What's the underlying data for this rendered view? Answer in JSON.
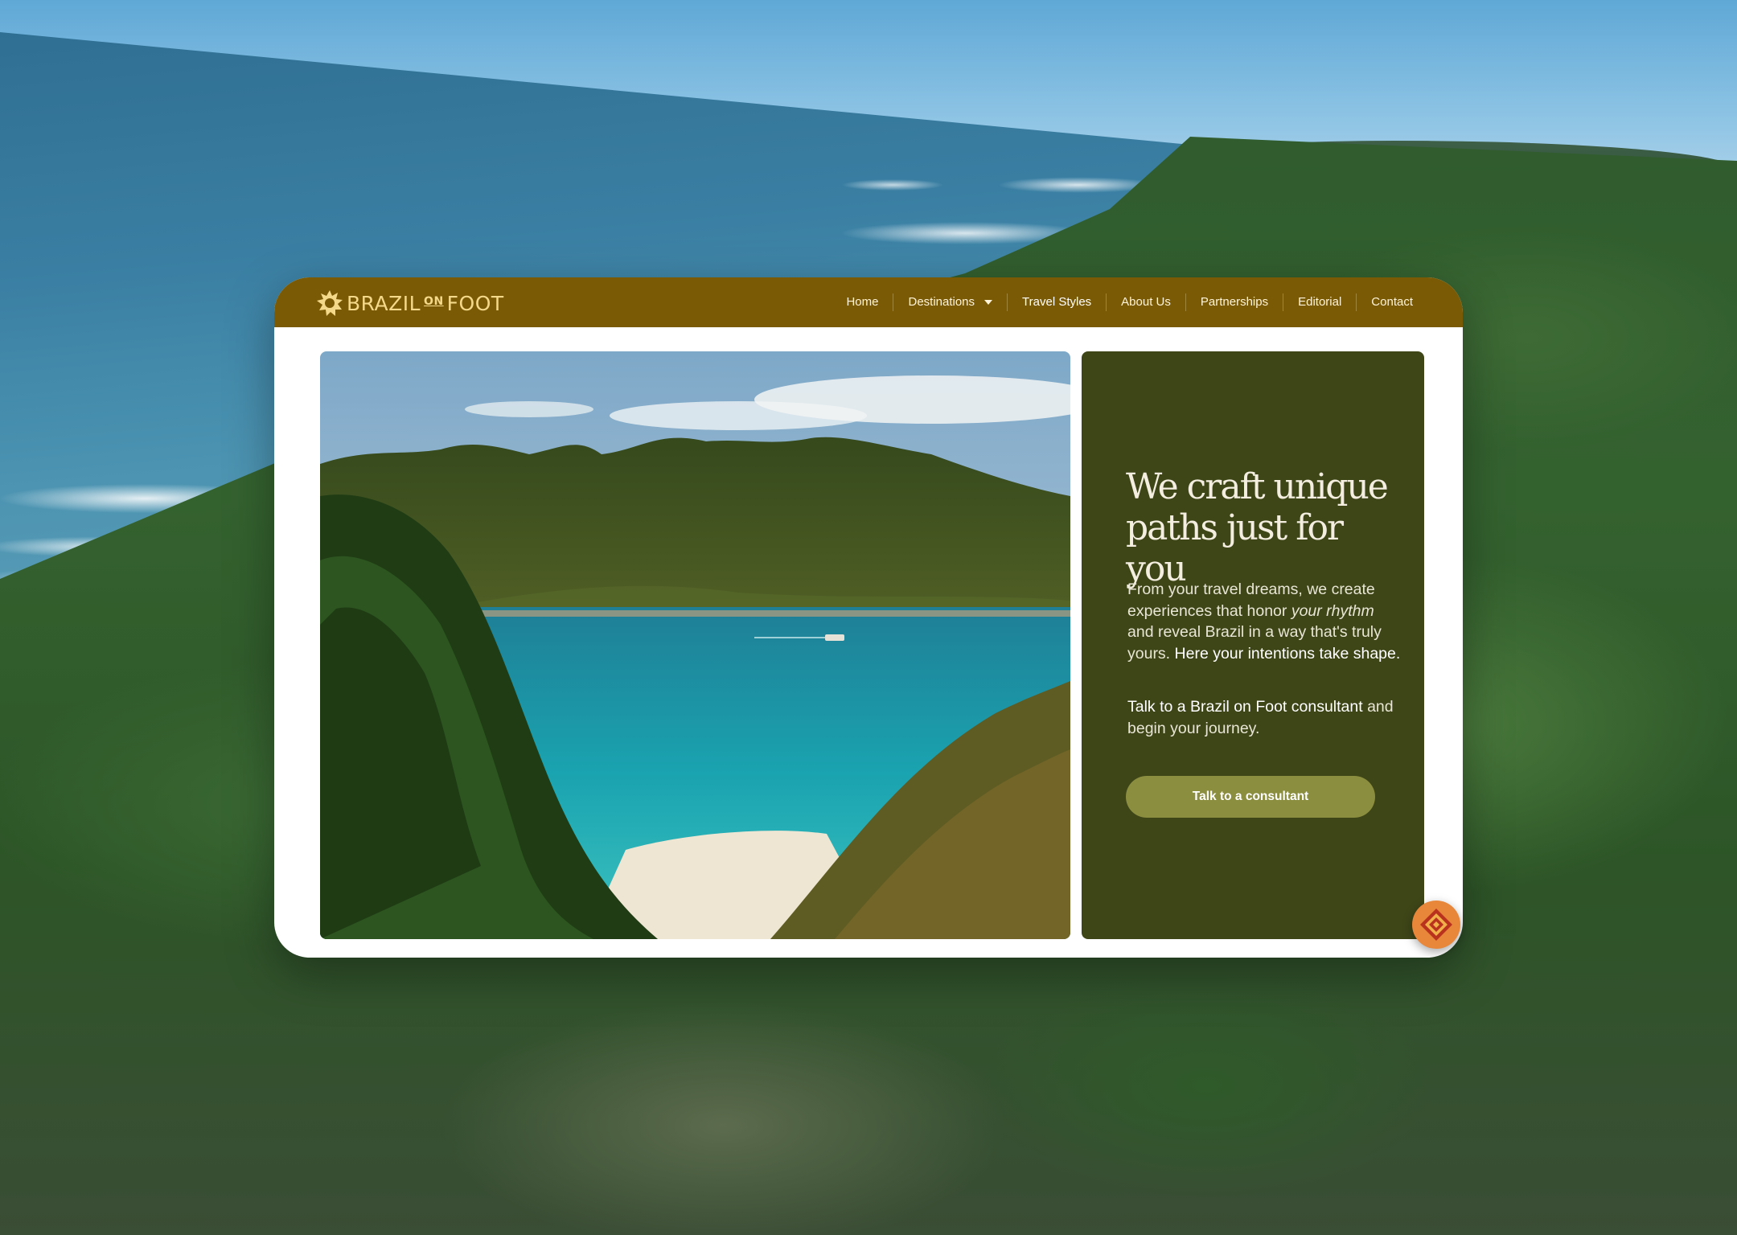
{
  "brand": {
    "name_part1": "BRAZIL",
    "name_on": "ON",
    "name_part2": "FOOT",
    "logo_color": "#f5d98a"
  },
  "nav": {
    "background": "#7a5a05",
    "items": [
      {
        "label": "Home"
      },
      {
        "label": "Destinations",
        "has_dropdown": true
      },
      {
        "label": "Travel Styles",
        "active": true
      },
      {
        "label": "About Us"
      },
      {
        "label": "Partnerships"
      },
      {
        "label": "Editorial"
      },
      {
        "label": "Contact"
      }
    ]
  },
  "hero": {
    "image": "coastal-bay-island-photo"
  },
  "panel": {
    "background": "#3e4618",
    "headline": "We craft unique paths just for you",
    "body_intro": "From your travel dreams, we create experiences that honor ",
    "body_emphasis": "your rhythm",
    "body_mid": " and reveal Brazil in a way that's truly yours. ",
    "body_highlight": "Here your intentions take shape.",
    "body_secondary_highlight": "Talk to a Brazil on Foot consultant",
    "body_secondary_rest": " and begin your journey.",
    "cta_label": "Talk to a consultant",
    "cta_color": "#8b8d3f"
  },
  "badge": {
    "icon": "brand-emblem-icon",
    "color": "#e8863a"
  }
}
